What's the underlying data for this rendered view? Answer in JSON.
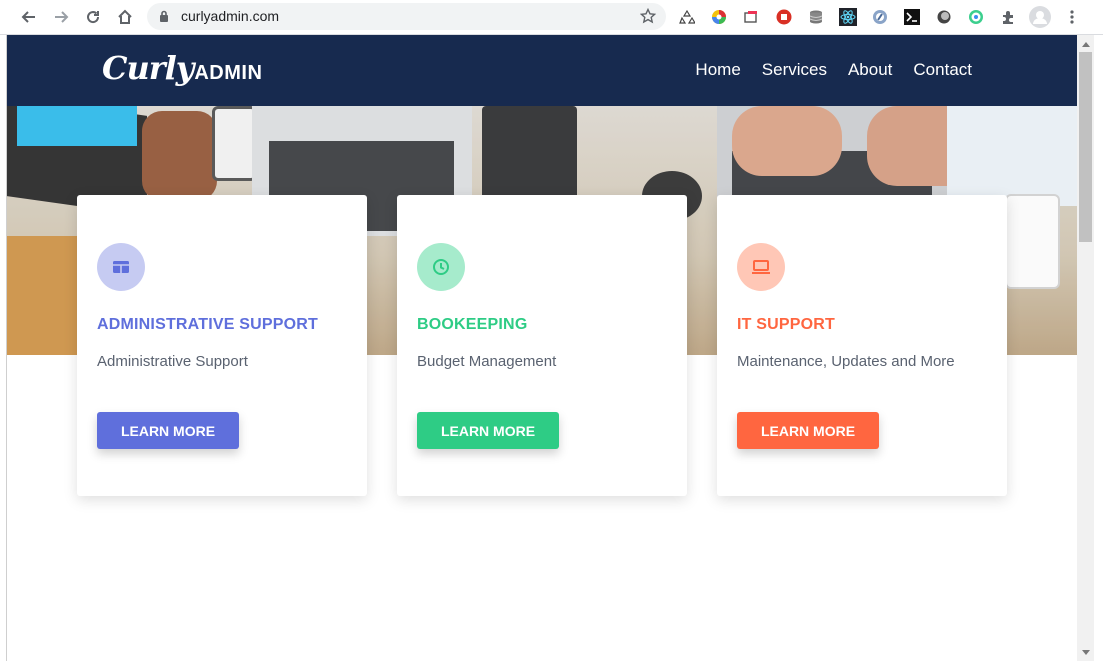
{
  "browser": {
    "url": "curlyadmin.com",
    "icons": [
      "back-icon",
      "forward-icon",
      "reload-icon",
      "home-icon",
      "lock-icon",
      "star-icon",
      "extensions-icon",
      "profile-icon",
      "menu-icon"
    ]
  },
  "site": {
    "logo_script": "Curly",
    "logo_caps": "ADMIN",
    "nav": [
      "Home",
      "Services",
      "About",
      "Contact"
    ],
    "header_color": "#172a4f"
  },
  "cards": [
    {
      "title": "ADMINISTRATIVE SUPPORT",
      "desc": "Administrative Support",
      "button": "LEARN MORE",
      "accent": "#5f6fdc",
      "icon_bg": "#c6cbf2",
      "icon": "table-icon"
    },
    {
      "title": "BOOKEEPING",
      "desc": "Budget Management",
      "button": "LEARN MORE",
      "accent": "#2ecc85",
      "icon_bg": "#a6ebcc",
      "icon": "clock-icon"
    },
    {
      "title": "IT SUPPORT",
      "desc": "Maintenance, Updates and More",
      "button": "LEARN MORE",
      "accent": "#ff6640",
      "icon_bg": "#ffc7b6",
      "icon": "laptop-icon"
    }
  ]
}
